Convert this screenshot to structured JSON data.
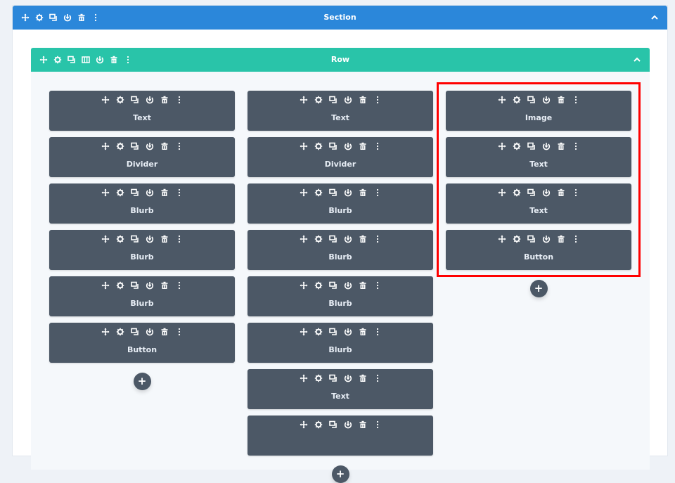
{
  "section": {
    "title": "Section",
    "color": "#2b87da",
    "toolbar_icons": [
      "move-icon",
      "settings-icon",
      "duplicate-icon",
      "power-icon",
      "trash-icon",
      "more-icon"
    ],
    "collapse_icon": "chevron-up-icon"
  },
  "row": {
    "title": "Row",
    "color": "#29c4a9",
    "toolbar_icons": [
      "move-icon",
      "settings-icon",
      "duplicate-icon",
      "columns-icon",
      "power-icon",
      "trash-icon",
      "more-icon"
    ],
    "collapse_icon": "chevron-up-icon"
  },
  "module_toolbar_icons": [
    "move-icon",
    "settings-icon",
    "duplicate-icon",
    "power-icon",
    "trash-icon",
    "more-icon"
  ],
  "columns": [
    {
      "modules": [
        {
          "label": "Text"
        },
        {
          "label": "Divider"
        },
        {
          "label": "Blurb"
        },
        {
          "label": "Blurb"
        },
        {
          "label": "Blurb"
        },
        {
          "label": "Button"
        }
      ],
      "add_label": "+"
    },
    {
      "modules": [
        {
          "label": "Text"
        },
        {
          "label": "Divider"
        },
        {
          "label": "Blurb"
        },
        {
          "label": "Blurb"
        },
        {
          "label": "Blurb"
        },
        {
          "label": "Blurb"
        },
        {
          "label": "Text"
        },
        {
          "label": ""
        }
      ],
      "add_label": "+"
    },
    {
      "modules": [
        {
          "label": "Image"
        },
        {
          "label": "Text"
        },
        {
          "label": "Text"
        },
        {
          "label": "Button"
        }
      ],
      "add_label": "+",
      "highlighted": true
    }
  ],
  "highlight_color": "#ff0000"
}
